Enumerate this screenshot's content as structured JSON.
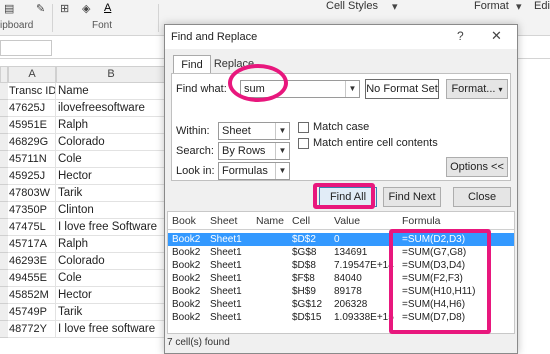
{
  "ribbon": {
    "clipboard_label": "ipboard",
    "font_label": "Font",
    "cell_styles": "Cell Styles",
    "format": "Format",
    "edit": "Edi"
  },
  "sheet": {
    "col_a": "A",
    "col_b": "B",
    "rows": [
      {
        "a": "Transc ID",
        "b": "Name"
      },
      {
        "a": "47625J",
        "b": "ilovefreesoftware"
      },
      {
        "a": "45951E",
        "b": "Ralph"
      },
      {
        "a": "46829G",
        "b": "Colorado"
      },
      {
        "a": "45711N",
        "b": "Cole"
      },
      {
        "a": "45925J",
        "b": "Hector"
      },
      {
        "a": "47803W",
        "b": "Tarik"
      },
      {
        "a": "47350P",
        "b": "Clinton"
      },
      {
        "a": "47475L",
        "b": "I love free Software"
      },
      {
        "a": "45717A",
        "b": "Ralph"
      },
      {
        "a": "46293E",
        "b": "Colorado"
      },
      {
        "a": "49455E",
        "b": "Cole"
      },
      {
        "a": "45852M",
        "b": "Hector"
      },
      {
        "a": "45749P",
        "b": "Tarik"
      },
      {
        "a": "48772Y",
        "b": "I love free software"
      }
    ]
  },
  "dialog": {
    "title": "Find and Replace",
    "help": "?",
    "close_glyph": "✕",
    "tabs": [
      "Find",
      "Replace"
    ],
    "find_what_label": "Find what:",
    "find_what_value": "sum",
    "no_format_set": "No Format Set",
    "format_button": "Format...",
    "within_label": "Within:",
    "within_value": "Sheet",
    "search_label": "Search:",
    "search_value": "By Rows",
    "look_in_label": "Look in:",
    "look_in_value": "Formulas",
    "match_case": "Match case",
    "match_entire": "Match entire cell contents",
    "options_button": "Options <<",
    "find_all": "Find All",
    "find_next": "Find Next",
    "close": "Close",
    "results_headers": [
      "Book",
      "Sheet",
      "Name",
      "Cell",
      "Value",
      "Formula"
    ],
    "results": [
      {
        "book": "Book2",
        "sheet": "Sheet1",
        "name": "",
        "cell": "$D$2",
        "value": "0",
        "formula": "=SUM(D2,D3)"
      },
      {
        "book": "Book2",
        "sheet": "Sheet1",
        "name": "",
        "cell": "$G$8",
        "value": "134691",
        "formula": "=SUM(G7,G8)"
      },
      {
        "book": "Book2",
        "sheet": "Sheet1",
        "name": "",
        "cell": "$D$8",
        "value": "7.19547E+14",
        "formula": "=SUM(D3,D4)"
      },
      {
        "book": "Book2",
        "sheet": "Sheet1",
        "name": "",
        "cell": "$F$8",
        "value": "84040",
        "formula": "=SUM(F2,F3)"
      },
      {
        "book": "Book2",
        "sheet": "Sheet1",
        "name": "",
        "cell": "$H$9",
        "value": "89178",
        "formula": "=SUM(H10,H11)"
      },
      {
        "book": "Book2",
        "sheet": "Sheet1",
        "name": "",
        "cell": "$G$12",
        "value": "206328",
        "formula": "=SUM(H4,H6)"
      },
      {
        "book": "Book2",
        "sheet": "Sheet1",
        "name": "",
        "cell": "$D$15",
        "value": "1.09338E+15",
        "formula": "=SUM(D7,D8)"
      }
    ],
    "status": "7 cell(s) found"
  },
  "colors": {
    "highlight": "#e8177d",
    "selection": "#3399ff"
  }
}
